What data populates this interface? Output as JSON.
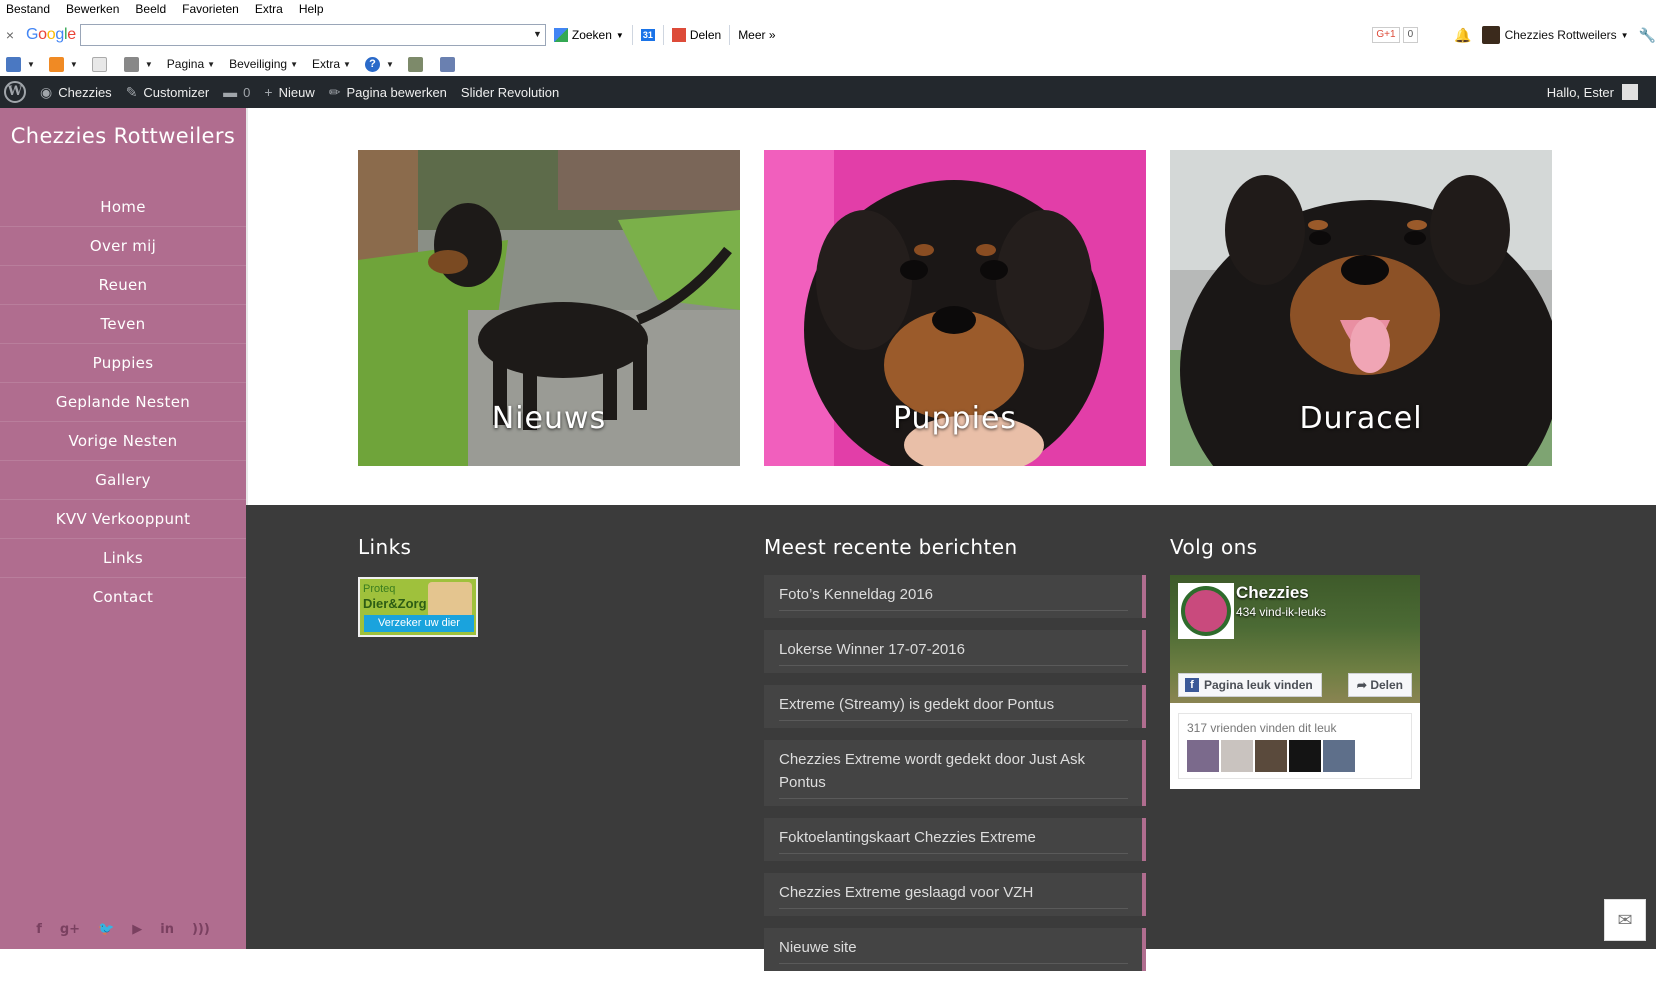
{
  "menubar": [
    "Bestand",
    "Bewerken",
    "Beeld",
    "Favorieten",
    "Extra",
    "Help"
  ],
  "google_toolbar": {
    "close": "×",
    "logo": [
      "G",
      "o",
      "o",
      "g",
      "l",
      "e"
    ],
    "search_value": "",
    "search_label": "Zoeken",
    "calendar_label": "31",
    "share_label": "Delen",
    "more_label": "Meer »",
    "gplus_label": "G+1",
    "gplus_count": "0",
    "account_name": "Chezzies Rottweilers"
  },
  "command_bar": {
    "pagina": "Pagina",
    "beveiliging": "Beveiliging",
    "extra": "Extra",
    "help": "?"
  },
  "wp_admin_bar": {
    "site": "Chezzies",
    "customizer": "Customizer",
    "comments_count": "0",
    "new": "Nieuw",
    "edit_page": "Pagina bewerken",
    "slider": "Slider Revolution",
    "greeting": "Hallo, Ester"
  },
  "sidebar": {
    "title": "Chezzies Rottweilers",
    "nav": [
      "Home",
      "Over mij",
      "Reuen",
      "Teven",
      "Puppies",
      "Geplande Nesten",
      "Vorige Nesten",
      "Gallery",
      "KVV Verkooppunt",
      "Links",
      "Contact"
    ],
    "social": [
      "f",
      "g+",
      "twitter",
      "youtube",
      "in",
      "rss"
    ]
  },
  "tiles": [
    {
      "caption": "Nieuws",
      "image": "rottweiler-puppy-standing"
    },
    {
      "caption": "Puppies",
      "image": "rottweiler-puppy-face"
    },
    {
      "caption": "Duracel",
      "image": "rottweiler-adult-face"
    }
  ],
  "footer": {
    "links_heading": "Links",
    "badge": {
      "line1": "Proteq",
      "line2": "Dier&Zorg",
      "button": "Verzeker uw dier"
    },
    "posts_heading": "Meest recente berichten",
    "posts": [
      "Foto’s Kenneldag 2016",
      "Lokerse Winner 17-07-2016",
      "Extreme (Streamy) is gedekt door Pontus",
      "Chezzies Extreme wordt gedekt door Just Ask Pontus",
      "Foktoelantingskaart Chezzies Extreme",
      "Chezzies Extreme geslaagd voor VZH",
      "Nieuwe site"
    ],
    "follow_heading": "Volg ons",
    "facebook": {
      "page_name": "Chezzies",
      "likes": "434 vind-ik-leuks",
      "like_button": "Pagina leuk vinden",
      "share_button": "Delen",
      "friends_text": "317 vrienden vinden dit leuk"
    }
  },
  "colors": {
    "sidebar": "#b06d8f",
    "wp_bar": "#23282d",
    "footer": "#3b3b3b",
    "post_bg": "#444444"
  }
}
